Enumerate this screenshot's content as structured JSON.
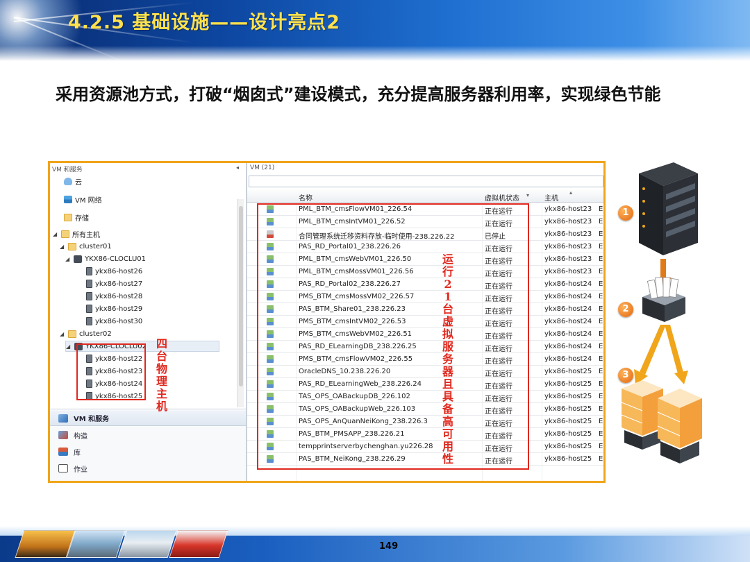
{
  "slide": {
    "title": "4.2.5 基础设施——设计亮点2",
    "subtitle": "采用资源池方式，打破“烟囱式”建设模式，充分提高服务器利用率，实现绿色节能",
    "page_number": "149"
  },
  "nav": {
    "title": "VM 和服务",
    "items": [
      {
        "label": "云",
        "icon": "cloud-icon"
      },
      {
        "label": "VM 网络",
        "icon": "vm-network-icon"
      },
      {
        "label": "存储",
        "icon": "storage-icon"
      },
      {
        "label": "所有主机",
        "icon": "folder-icon"
      },
      {
        "label": "cluster01",
        "icon": "folder-icon"
      },
      {
        "label": "YKX86-CLOCLU01",
        "icon": "cluster-icon"
      },
      {
        "label": "ykx86-host26",
        "icon": "host-icon"
      },
      {
        "label": "ykx86-host27",
        "icon": "host-icon"
      },
      {
        "label": "ykx86-host28",
        "icon": "host-icon"
      },
      {
        "label": "ykx86-host29",
        "icon": "host-icon"
      },
      {
        "label": "ykx86-host30",
        "icon": "host-icon"
      },
      {
        "label": "cluster02",
        "icon": "folder-icon"
      },
      {
        "label": "YKX86-CLOCLU02",
        "icon": "cluster-icon"
      },
      {
        "label": "ykx86-host22",
        "icon": "host-icon"
      },
      {
        "label": "ykx86-host23",
        "icon": "host-icon"
      },
      {
        "label": "ykx86-host24",
        "icon": "host-icon"
      },
      {
        "label": "ykx86-host25",
        "icon": "host-icon"
      }
    ],
    "bottom_buttons": [
      "VM 和服务",
      "构造",
      "库",
      "作业"
    ]
  },
  "list": {
    "title": "VM (21)",
    "columns": {
      "name": "名称",
      "status": "虚拟机状态",
      "host": "主机"
    },
    "rows": [
      {
        "name": "PML_BTM_cmsFlowVM01_226.54",
        "status": "正在运行",
        "host": "ykx86-host23"
      },
      {
        "name": "PML_BTM_cmsIntVM01_226.52",
        "status": "正在运行",
        "host": "ykx86-host23"
      },
      {
        "name": "合同管理系统迁移资料存放-临时使用-238.226.22",
        "status": "已停止",
        "host": "ykx86-host23"
      },
      {
        "name": "PAS_RD_Portal01_238.226.26",
        "status": "正在运行",
        "host": "ykx86-host23"
      },
      {
        "name": "PML_BTM_cmsWebVM01_226.50",
        "status": "正在运行",
        "host": "ykx86-host23"
      },
      {
        "name": "PML_BTM_cmsMossVM01_226.56",
        "status": "正在运行",
        "host": "ykx86-host23"
      },
      {
        "name": "PAS_RD_Portal02_238.226.27",
        "status": "正在运行",
        "host": "ykx86-host24"
      },
      {
        "name": "PMS_BTM_cmsMossVM02_226.57",
        "status": "正在运行",
        "host": "ykx86-host24"
      },
      {
        "name": "PAS_BTM_Share01_238.226.23",
        "status": "正在运行",
        "host": "ykx86-host24"
      },
      {
        "name": "PMS_BTM_cmsIntVM02_226.53",
        "status": "正在运行",
        "host": "ykx86-host24"
      },
      {
        "name": "PMS_BTM_cmsWebVM02_226.51",
        "status": "正在运行",
        "host": "ykx86-host24"
      },
      {
        "name": "PAS_RD_ELearningDB_238.226.25",
        "status": "正在运行",
        "host": "ykx86-host24"
      },
      {
        "name": "PMS_BTM_cmsFlowVM02_226.55",
        "status": "正在运行",
        "host": "ykx86-host24"
      },
      {
        "name": "OracleDNS_10.238.226.20",
        "status": "正在运行",
        "host": "ykx86-host25"
      },
      {
        "name": "PAS_RD_ELearningWeb_238.226.24",
        "status": "正在运行",
        "host": "ykx86-host25"
      },
      {
        "name": "TAS_OPS_OABackupDB_226.102",
        "status": "正在运行",
        "host": "ykx86-host25"
      },
      {
        "name": "TAS_OPS_OABackupWeb_226.103",
        "status": "正在运行",
        "host": "ykx86-host25"
      },
      {
        "name": "PAS_OPS_AnQuanNeiKong_238.226.3",
        "status": "正在运行",
        "host": "ykx86-host25"
      },
      {
        "name": "PAS_BTM_PMSAPP_238.226.21",
        "status": "正在运行",
        "host": "ykx86-host25"
      },
      {
        "name": "tempprintserverbychenghan.yu226.28",
        "status": "正在运行",
        "host": "ykx86-host25"
      },
      {
        "name": "PAS_BTM_NeiKong_238.226.29",
        "status": "正在运行",
        "host": "ykx86-host25"
      }
    ],
    "trailing_glyph": "E"
  },
  "annotations": {
    "hosts_label": "四台物理主机",
    "vms_label": "运行21台虚拟服务器且具备高可用性",
    "color": "#e0281e"
  },
  "illustration": {
    "steps": [
      "1",
      "2",
      "3"
    ],
    "accent_color": "#f0a51a"
  },
  "colors": {
    "title_yellow": "#ffe14d",
    "header_blue": "#0d47a1",
    "window_border": "#f0a51a"
  }
}
